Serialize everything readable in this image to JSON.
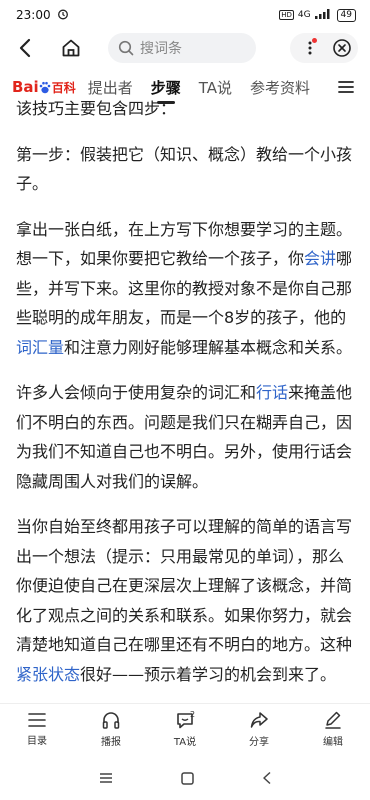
{
  "status_bar": {
    "time": "23:00",
    "network": "4G",
    "battery": "49"
  },
  "nav": {
    "search_placeholder": "搜词条"
  },
  "tabs": {
    "logo_bai": "Bai",
    "logo_du": "du",
    "logo_baike": "百科",
    "items": [
      "提出者",
      "步骤",
      "TA说",
      "参考资料"
    ]
  },
  "article": {
    "p0": "该技巧主要包含四步：",
    "p1": "第一步：假装把它（知识、概念）教给一个小孩子。",
    "p2_a": "拿出一张白纸，在上方写下你想要学习的主题。想一下，如果你要把它教给一个孩子，你",
    "p2_link1": "会讲",
    "p2_b": "哪些，并写下来。这里你的教授对象不是你自己那些聪明的成年朋友，而是一个8岁的孩子，他的",
    "p2_link2": "词汇量",
    "p2_c": "和注意力刚好能够理解基本概念和关系。",
    "p3_a": "许多人会倾向于使用复杂的词汇和",
    "p3_link": "行话",
    "p3_b": "来掩盖他们不明白的东西。问题是我们只在糊弄自己，因为我们不知道自己也不明白。另外，使用行话会隐藏周围人对我们的误解。",
    "p4_a": "当你自始至终都用孩子可以理解的简单的语言写出一个想法（提示：只用最常见的单词），那么你便迫使自己在更深层次上理解了该概念，并简化了观点之间的关系和联系。如果你努力，就会清楚地知道自己在哪里还有不明白的地方。这种",
    "p4_link": "紧张状态",
    "p4_b": "很好——预示着学习的机会到来了。"
  },
  "bottom_bar": {
    "toc": "目录",
    "listen": "播报",
    "ta_say": "TA说",
    "ta_count": "2",
    "share": "分享",
    "edit": "编辑"
  }
}
